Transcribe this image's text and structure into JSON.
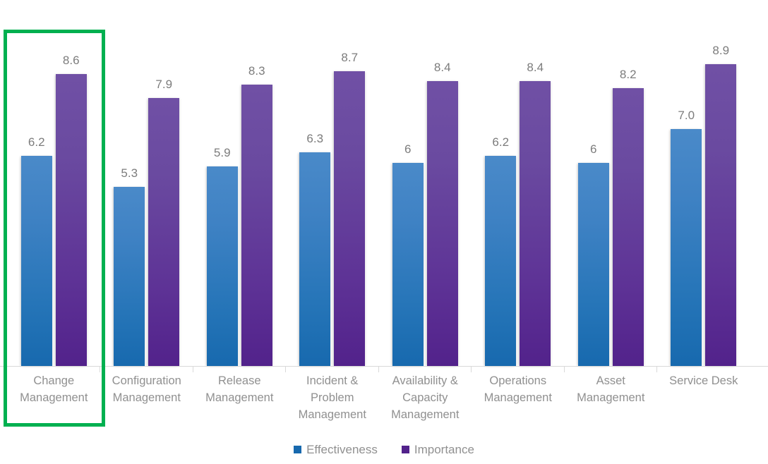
{
  "chart_data": {
    "type": "bar",
    "title": "",
    "subtitle": "",
    "xlabel": "",
    "ylabel": "",
    "ylim": [
      0,
      10
    ],
    "grid": false,
    "legend_position": "bottom",
    "categories": [
      "Change Management",
      "Configuration Management",
      "Release Management",
      "Incident & Problem Management",
      "Availability & Capacity Management",
      "Operations Management",
      "Asset Management",
      "Service Desk"
    ],
    "category_lines": [
      [
        "Change",
        "Management"
      ],
      [
        "Configuration",
        "Management"
      ],
      [
        "Release",
        "Management"
      ],
      [
        "Incident &",
        "Problem",
        "Management"
      ],
      [
        "Availability &",
        "Capacity",
        "Management"
      ],
      [
        "Operations",
        "Management"
      ],
      [
        "Asset",
        "Management"
      ],
      [
        "Service Desk"
      ]
    ],
    "series": [
      {
        "name": "Effectiveness",
        "color": "#1769ae",
        "values": [
          6.2,
          5.3,
          5.9,
          6.3,
          6.0,
          6.2,
          6.0,
          7.0
        ],
        "labels": [
          "6.2",
          "5.3",
          "5.9",
          "6.3",
          "6",
          "6.2",
          "6",
          "7.0"
        ]
      },
      {
        "name": "Importance",
        "color": "#52228b",
        "values": [
          8.6,
          7.9,
          8.3,
          8.7,
          8.4,
          8.4,
          8.2,
          8.9
        ],
        "labels": [
          "8.6",
          "7.9",
          "8.3",
          "8.7",
          "8.4",
          "8.4",
          "8.2",
          "8.9"
        ]
      }
    ]
  },
  "annotations": {
    "highlight": {
      "target_category": "Change Management",
      "color": "#00b050"
    }
  },
  "legend": {
    "items": [
      {
        "label": "Effectiveness",
        "color": "#1769ae"
      },
      {
        "label": "Importance",
        "color": "#52228b"
      }
    ]
  }
}
